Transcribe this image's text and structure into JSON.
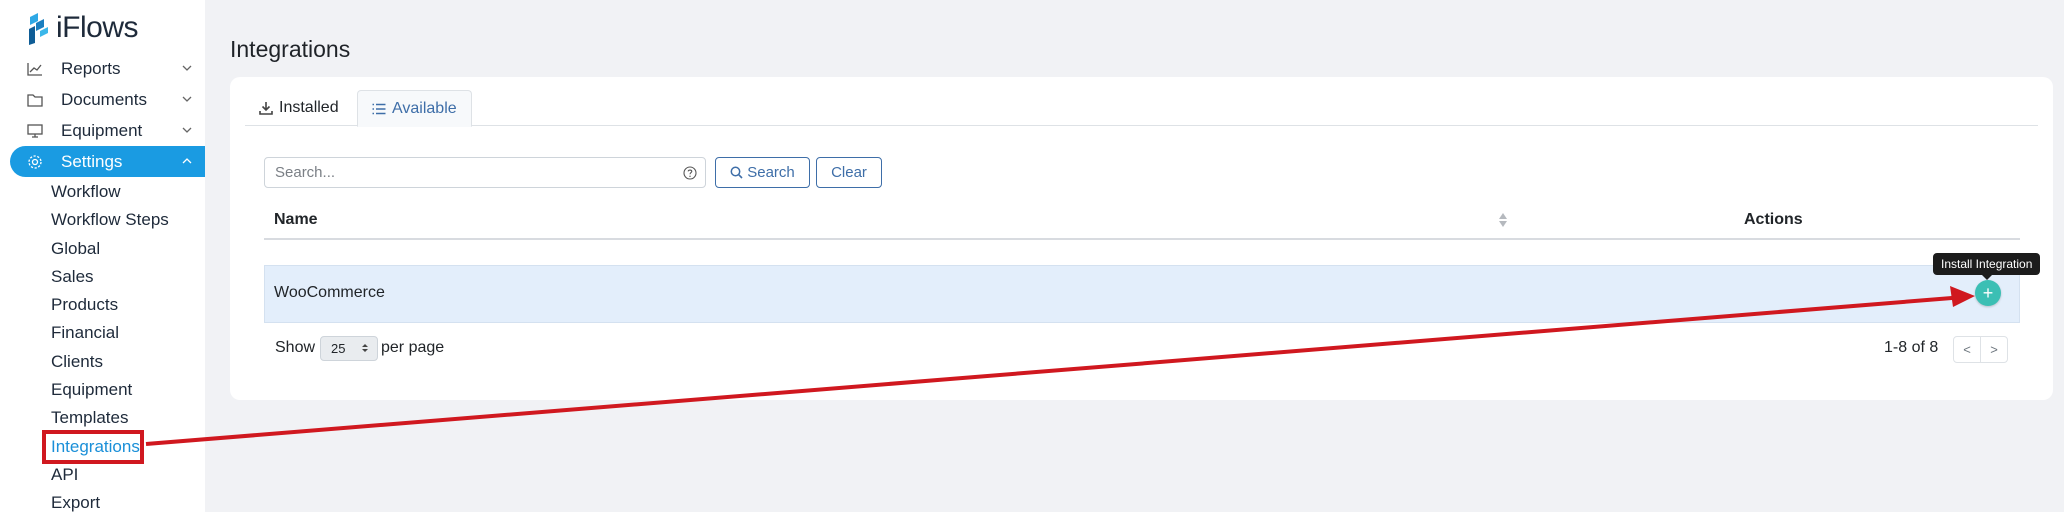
{
  "app": {
    "logo_text": "iFlows",
    "accent_color": "#1a9be2",
    "annotation_color": "#d0181f"
  },
  "sidebar": {
    "items": [
      {
        "label": "Reports",
        "icon": "chart-line-icon",
        "expanded": false
      },
      {
        "label": "Documents",
        "icon": "folder-icon",
        "expanded": false
      },
      {
        "label": "Equipment",
        "icon": "monitor-icon",
        "expanded": false
      },
      {
        "label": "Settings",
        "icon": "gear-icon",
        "expanded": true,
        "active": true
      }
    ],
    "settings_subitems": [
      {
        "label": "Workflow"
      },
      {
        "label": "Workflow Steps"
      },
      {
        "label": "Global"
      },
      {
        "label": "Sales"
      },
      {
        "label": "Products"
      },
      {
        "label": "Financial"
      },
      {
        "label": "Clients"
      },
      {
        "label": "Equipment"
      },
      {
        "label": "Templates"
      },
      {
        "label": "Integrations",
        "active": true
      },
      {
        "label": "API"
      },
      {
        "label": "Export"
      }
    ]
  },
  "main": {
    "title": "Integrations",
    "tabs": [
      {
        "label": "Installed",
        "icon": "download-icon",
        "active": false
      },
      {
        "label": "Available",
        "icon": "list-icon",
        "active": true
      }
    ],
    "search": {
      "placeholder": "Search...",
      "value": "",
      "search_label": "Search",
      "clear_label": "Clear"
    },
    "table": {
      "columns": [
        "Name",
        "Actions"
      ],
      "rows": [
        {
          "name": "WooCommerce"
        }
      ],
      "install_tooltip": "Install Integration",
      "install_icon": "plus-icon"
    },
    "footer": {
      "show_label": "Show",
      "per_page_value": "25",
      "per_page_label": "per page",
      "pagination_info": "1-8 of 8",
      "prev": "<",
      "next": ">"
    }
  }
}
